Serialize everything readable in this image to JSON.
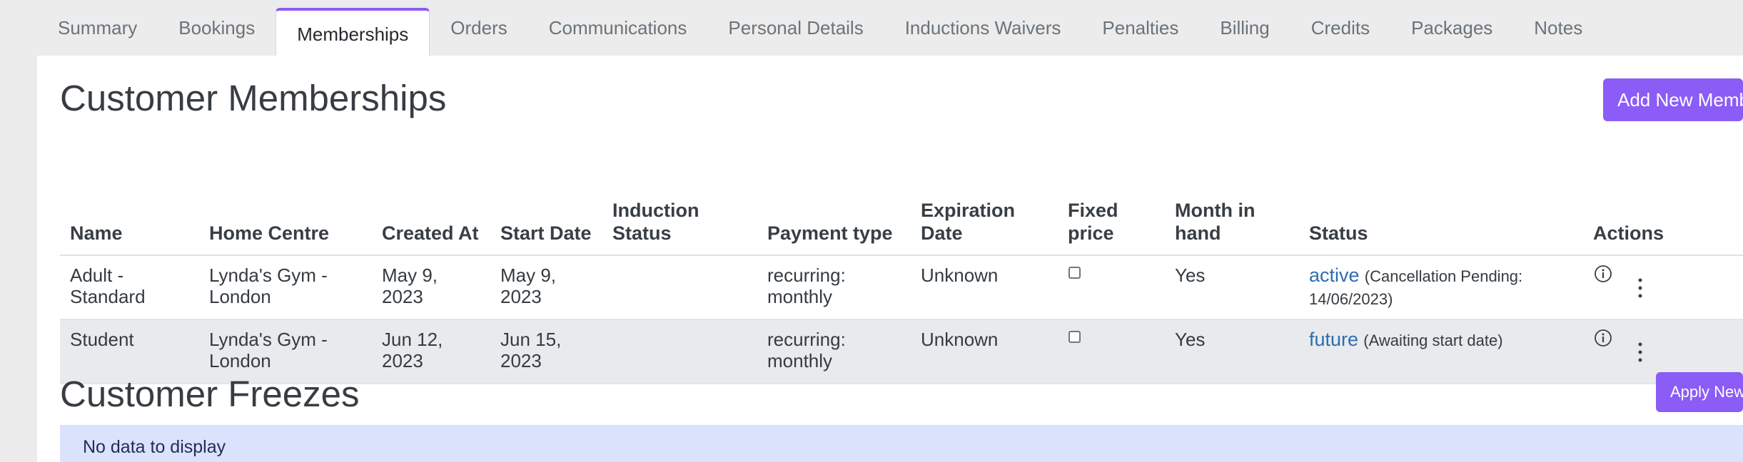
{
  "tabs": [
    {
      "label": "Summary",
      "active": false
    },
    {
      "label": "Bookings",
      "active": false
    },
    {
      "label": "Memberships",
      "active": true
    },
    {
      "label": "Orders",
      "active": false
    },
    {
      "label": "Communications",
      "active": false
    },
    {
      "label": "Personal Details",
      "active": false
    },
    {
      "label": "Inductions Waivers",
      "active": false
    },
    {
      "label": "Penalties",
      "active": false
    },
    {
      "label": "Billing",
      "active": false
    },
    {
      "label": "Credits",
      "active": false
    },
    {
      "label": "Packages",
      "active": false
    },
    {
      "label": "Notes",
      "active": false
    }
  ],
  "memberships": {
    "title": "Customer Memberships",
    "add_button_label": "Add New Membership",
    "columns": {
      "name": "Name",
      "home_centre": "Home Centre",
      "created_at": "Created At",
      "start_date": "Start Date",
      "induction_status_1": "Induction",
      "induction_status_2": "Status",
      "payment_type": "Payment type",
      "expiration_date_1": "Expiration",
      "expiration_date_2": "Date",
      "fixed_price_1": "Fixed",
      "fixed_price_2": "price",
      "month_in_hand_1": "Month in",
      "month_in_hand_2": "hand",
      "status": "Status",
      "actions": "Actions"
    },
    "rows": [
      {
        "name_1": "Adult -",
        "name_2": "Standard",
        "home_centre_1": "Lynda's Gym -",
        "home_centre_2": "London",
        "created_at_1": "May 9,",
        "created_at_2": "2023",
        "start_date_1": "May 9,",
        "start_date_2": "2023",
        "induction_status": "",
        "payment_type_1": "recurring:",
        "payment_type_2": "monthly",
        "expiration_date": "Unknown",
        "fixed_price": false,
        "month_in_hand": "Yes",
        "status_label": "active",
        "status_note_1": "(Cancellation Pending:",
        "status_note_2": "14/06/2023)"
      },
      {
        "name_1": "Student",
        "name_2": "",
        "home_centre_1": "Lynda's Gym -",
        "home_centre_2": "London",
        "created_at_1": "Jun 12,",
        "created_at_2": "2023",
        "start_date_1": "Jun 15,",
        "start_date_2": "2023",
        "induction_status": "",
        "payment_type_1": "recurring:",
        "payment_type_2": "monthly",
        "expiration_date": "Unknown",
        "fixed_price": false,
        "month_in_hand": "Yes",
        "status_label": "future",
        "status_note_1": "(Awaiting start date)",
        "status_note_2": ""
      }
    ]
  },
  "freezes": {
    "title": "Customer Freezes",
    "apply_button_label": "Apply New Freeze",
    "empty_text": "No data to display"
  },
  "colors": {
    "accent": "#8b5cf6",
    "link": "#2f6db0",
    "empty_bg": "#dbe2fc"
  }
}
